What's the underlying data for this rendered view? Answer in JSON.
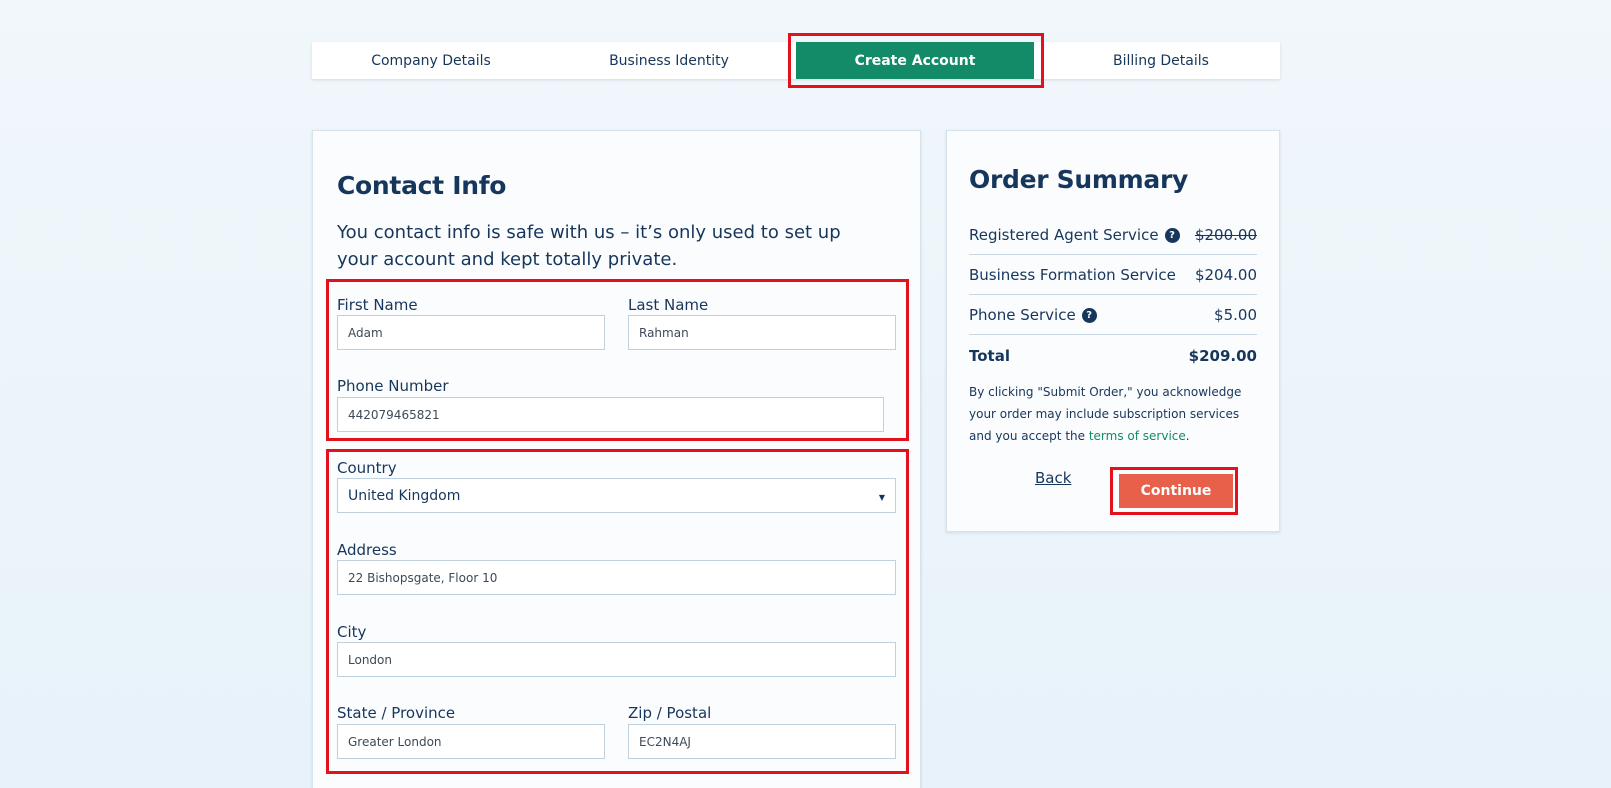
{
  "steps": [
    {
      "label": "Company Details"
    },
    {
      "label": "Business Identity"
    },
    {
      "label": "Create Account"
    },
    {
      "label": "Billing Details"
    }
  ],
  "contact": {
    "title": "Contact Info",
    "intro": "You contact info is safe with us – it’s only used to set up your account and kept totally private.",
    "first_name": {
      "label": "First Name",
      "value": "Adam"
    },
    "last_name": {
      "label": "Last Name",
      "value": "Rahman"
    },
    "phone": {
      "label": "Phone Number",
      "value": "442079465821"
    },
    "country": {
      "label": "Country",
      "value": "United Kingdom"
    },
    "address": {
      "label": "Address",
      "value": "22 Bishopsgate, Floor 10"
    },
    "city": {
      "label": "City",
      "value": "London"
    },
    "state": {
      "label": "State / Province",
      "value": "Greater London"
    },
    "zip": {
      "label": "Zip / Postal",
      "value": "EC2N4AJ"
    }
  },
  "summary": {
    "title": "Order Summary",
    "items": [
      {
        "name": "Registered Agent Service",
        "price": "$200.00",
        "help": "?"
      },
      {
        "name": "Business Formation Service",
        "price": "$204.00"
      },
      {
        "name": "Phone Service",
        "price": "$5.00",
        "help": "?"
      }
    ],
    "total_label": "Total",
    "total_value": "$209.00",
    "legal_before": "By clicking \"Submit Order,\" you acknowledge your order may include subscription services and you accept the ",
    "legal_link": "terms of service",
    "legal_after": ".",
    "back_label": "Back",
    "continue_label": "Continue"
  },
  "colors": {
    "accent": "#138a68",
    "cta": "#e8604a",
    "highlight": "#e3101d",
    "text": "#16365c"
  }
}
